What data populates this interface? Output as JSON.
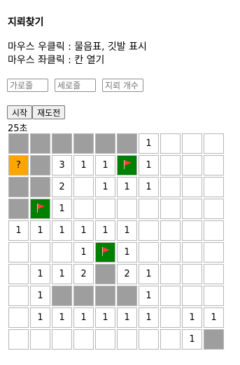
{
  "title": "지뢰찾기",
  "help": [
    "마우스 우클릭 : 물음표, 깃발 표시",
    "마우스 좌클릭 : 칸 열기"
  ],
  "inputs": {
    "rows_placeholder": "가로줄",
    "cols_placeholder": "세로줄",
    "mines_placeholder": "지뢰 개수"
  },
  "buttons": {
    "start": "시작",
    "restart": "재도전"
  },
  "timer": "25초",
  "colors": {
    "closed": "#9e9e9e",
    "question": "#ffa500",
    "flag": "#008000",
    "open": "#ffffff"
  },
  "board": [
    [
      {
        "s": "closed"
      },
      {
        "s": "closed"
      },
      {
        "s": "closed"
      },
      {
        "s": "closed"
      },
      {
        "s": "closed"
      },
      {
        "s": "closed"
      },
      {
        "s": "open",
        "v": "1"
      },
      {
        "s": "open"
      },
      {
        "s": "open"
      },
      {
        "s": "open"
      }
    ],
    [
      {
        "s": "question",
        "v": "?"
      },
      {
        "s": "closed"
      },
      {
        "s": "open",
        "v": "3"
      },
      {
        "s": "open",
        "v": "1"
      },
      {
        "s": "open",
        "v": "1"
      },
      {
        "s": "flag"
      },
      {
        "s": "open",
        "v": "1"
      },
      {
        "s": "open"
      },
      {
        "s": "open"
      },
      {
        "s": "open"
      }
    ],
    [
      {
        "s": "closed"
      },
      {
        "s": "closed"
      },
      {
        "s": "open",
        "v": "2"
      },
      {
        "s": "open"
      },
      {
        "s": "open",
        "v": "1"
      },
      {
        "s": "open",
        "v": "1"
      },
      {
        "s": "open",
        "v": "1"
      },
      {
        "s": "open"
      },
      {
        "s": "open"
      },
      {
        "s": "open"
      }
    ],
    [
      {
        "s": "closed"
      },
      {
        "s": "flag"
      },
      {
        "s": "open",
        "v": "1"
      },
      {
        "s": "open"
      },
      {
        "s": "open"
      },
      {
        "s": "open"
      },
      {
        "s": "open"
      },
      {
        "s": "open"
      },
      {
        "s": "open"
      },
      {
        "s": "open"
      }
    ],
    [
      {
        "s": "open",
        "v": "1"
      },
      {
        "s": "open",
        "v": "1"
      },
      {
        "s": "open",
        "v": "1"
      },
      {
        "s": "open",
        "v": "1"
      },
      {
        "s": "open",
        "v": "1"
      },
      {
        "s": "open",
        "v": "1"
      },
      {
        "s": "open"
      },
      {
        "s": "open"
      },
      {
        "s": "open"
      },
      {
        "s": "open"
      }
    ],
    [
      {
        "s": "open"
      },
      {
        "s": "open"
      },
      {
        "s": "open"
      },
      {
        "s": "open",
        "v": "1"
      },
      {
        "s": "flag"
      },
      {
        "s": "open",
        "v": "1"
      },
      {
        "s": "open"
      },
      {
        "s": "open"
      },
      {
        "s": "open"
      },
      {
        "s": "open"
      }
    ],
    [
      {
        "s": "open"
      },
      {
        "s": "open",
        "v": "1"
      },
      {
        "s": "open",
        "v": "1"
      },
      {
        "s": "open",
        "v": "2"
      },
      {
        "s": "closed"
      },
      {
        "s": "open",
        "v": "2"
      },
      {
        "s": "open",
        "v": "1"
      },
      {
        "s": "open"
      },
      {
        "s": "open"
      },
      {
        "s": "open"
      }
    ],
    [
      {
        "s": "open"
      },
      {
        "s": "open",
        "v": "1"
      },
      {
        "s": "closed"
      },
      {
        "s": "closed"
      },
      {
        "s": "closed"
      },
      {
        "s": "closed"
      },
      {
        "s": "open",
        "v": "1"
      },
      {
        "s": "open"
      },
      {
        "s": "open"
      },
      {
        "s": "open"
      }
    ],
    [
      {
        "s": "open"
      },
      {
        "s": "open",
        "v": "1"
      },
      {
        "s": "open",
        "v": "1"
      },
      {
        "s": "open",
        "v": "1"
      },
      {
        "s": "open",
        "v": "1"
      },
      {
        "s": "open",
        "v": "1"
      },
      {
        "s": "open",
        "v": "1"
      },
      {
        "s": "open"
      },
      {
        "s": "open",
        "v": "1"
      },
      {
        "s": "open",
        "v": "1"
      }
    ],
    [
      {
        "s": "open"
      },
      {
        "s": "open"
      },
      {
        "s": "open"
      },
      {
        "s": "open"
      },
      {
        "s": "open"
      },
      {
        "s": "open"
      },
      {
        "s": "open"
      },
      {
        "s": "open"
      },
      {
        "s": "open",
        "v": "1"
      },
      {
        "s": "closed"
      }
    ]
  ]
}
